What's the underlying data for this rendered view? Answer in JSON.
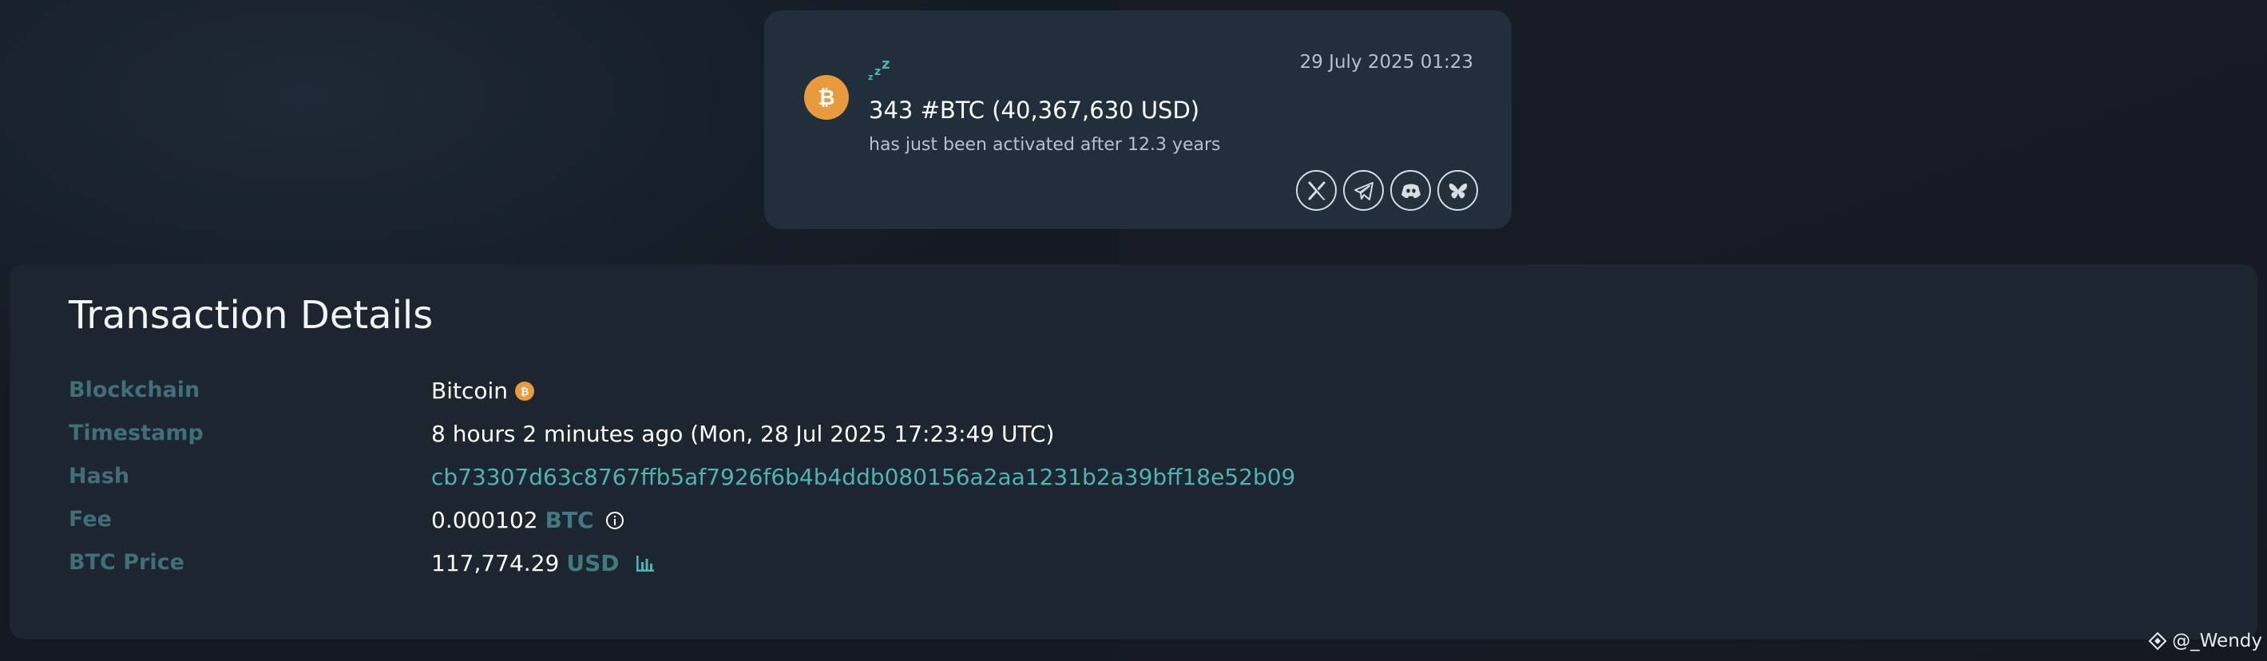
{
  "alert": {
    "date": "29 July 2025 01:23",
    "title": "343 #BTC (40,367,630 USD)",
    "subtitle": "has just been activated after 12.3 years",
    "icons": [
      "bitcoin-icon",
      "sleep-icon"
    ],
    "share": [
      {
        "name": "x-share",
        "icon": "x-icon"
      },
      {
        "name": "telegram-share",
        "icon": "telegram-icon"
      },
      {
        "name": "discord-share",
        "icon": "discord-icon"
      },
      {
        "name": "bluesky-share",
        "icon": "bluesky-icon"
      }
    ]
  },
  "details": {
    "title": "Transaction Details",
    "blockchain": {
      "label": "Blockchain",
      "value": "Bitcoin"
    },
    "timestamp": {
      "label": "Timestamp",
      "value": "8 hours 2 minutes ago (Mon, 28 Jul 2025 17:23:49 UTC)"
    },
    "hash": {
      "label": "Hash",
      "value": "cb73307d63c8767ffb5af7926f6b4b4ddb080156a2aa1231b2a39bff18e52b09"
    },
    "fee": {
      "label": "Fee",
      "value": "0.000102",
      "unit": "BTC"
    },
    "price": {
      "label": "BTC Price",
      "value": "117,774.29",
      "unit": "USD"
    }
  },
  "watermark": {
    "text": "@_Wendy"
  },
  "colors": {
    "accent": "#4fb3b3",
    "label": "#3f6f78",
    "bitcoin": "#e89a3c",
    "card": "#212e3b",
    "panel": "#1c2530"
  }
}
